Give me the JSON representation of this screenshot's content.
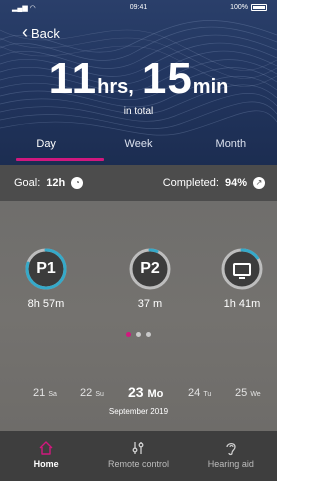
{
  "status_bar": {
    "time": "09:41",
    "battery": "100%"
  },
  "header": {
    "back_label": "Back",
    "hours_value": "11",
    "hours_unit": "hrs,",
    "minutes_value": "15",
    "minutes_unit": "min",
    "total_caption": "in total"
  },
  "tabs": [
    {
      "label": "Day",
      "active": true
    },
    {
      "label": "Week",
      "active": false
    },
    {
      "label": "Month",
      "active": false
    }
  ],
  "goal": {
    "label": "Goal:",
    "value": "12h"
  },
  "completed": {
    "label": "Completed:",
    "value": "94%"
  },
  "programs": [
    {
      "label": "P1",
      "duration": "8h 57m",
      "icon": "p1-badge",
      "progress": 0.8
    },
    {
      "label": "P2",
      "duration": "37 m",
      "icon": "p2-badge",
      "progress": 0.06
    },
    {
      "label": "",
      "duration": "1h 41m",
      "icon": "tv-icon",
      "progress": 0.15
    }
  ],
  "pager": {
    "pages": 3,
    "active": 0
  },
  "dates": [
    {
      "day": "21",
      "weekday": "Sa",
      "selected": false
    },
    {
      "day": "22",
      "weekday": "Su",
      "selected": false
    },
    {
      "day": "23",
      "weekday": "Mo",
      "selected": true
    },
    {
      "day": "24",
      "weekday": "Tu",
      "selected": false
    },
    {
      "day": "25",
      "weekday": "We",
      "selected": false
    }
  ],
  "month_label": "September 2019",
  "bottom_nav": [
    {
      "label": "Home",
      "icon": "home-icon",
      "active": true
    },
    {
      "label": "Remote control",
      "icon": "sliders-icon",
      "active": false
    },
    {
      "label": "Hearing aid",
      "icon": "ear-icon",
      "active": false
    }
  ],
  "colors": {
    "accent": "#d1187e",
    "ring_track": "#bdbdbd",
    "ring_progress": "#35a9c9",
    "header_bg": "#223660"
  }
}
